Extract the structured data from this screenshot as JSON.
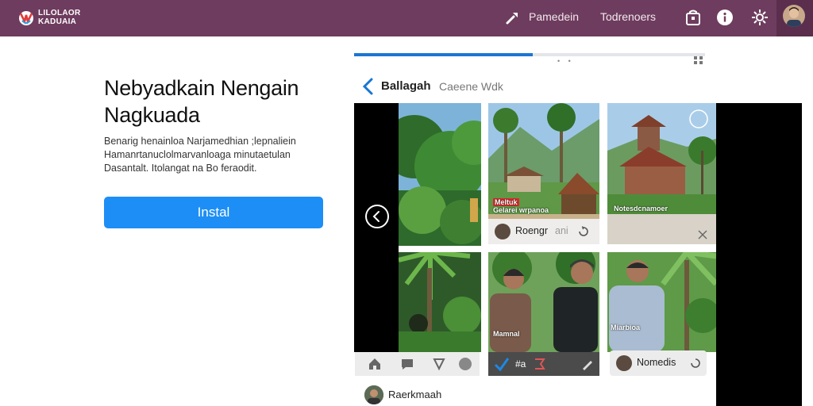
{
  "topbar": {
    "logo_line1": "LILOLAOR",
    "logo_line2": "KADUAIA",
    "nav_links": [
      "Pamedein",
      "Todrenoers"
    ],
    "background": "#6e3c5e"
  },
  "hero": {
    "title_line1": "Nebyadkain Nengain",
    "title_line2": "Nagkuada",
    "description": "Benarig henainloa Narjamedhian ;lepnaliein Hamanrtanuclolmarvanloaga minutaetulan Dasantalt. Itolangat na Bo feraodit.",
    "install_label": "Instal",
    "accent": "#1d8ef5"
  },
  "device": {
    "progress": 0.51,
    "status_dots": "• •",
    "header_title": "Ballagah",
    "header_subtitle": "Caeene Wdk",
    "tiles": [
      {
        "overlay": "",
        "caption": ""
      },
      {
        "overlay_red": "Meltuk",
        "overlay": "Gelarei wrpanoa",
        "caption_user": "Roengr",
        "caption_tag": "ani"
      },
      {
        "overlay": "Notesdcnamoer",
        "caption": ""
      },
      {
        "overlay": "",
        "caption": ""
      },
      {
        "overlay": "Mamnal",
        "caption": ""
      },
      {
        "overlay": "Miarbioa",
        "caption_user": "Nomedis"
      }
    ],
    "bottom_bar_left_text": "",
    "bottom_bar_mid_text": "#a",
    "bottom_user": "Raerkmaah"
  }
}
